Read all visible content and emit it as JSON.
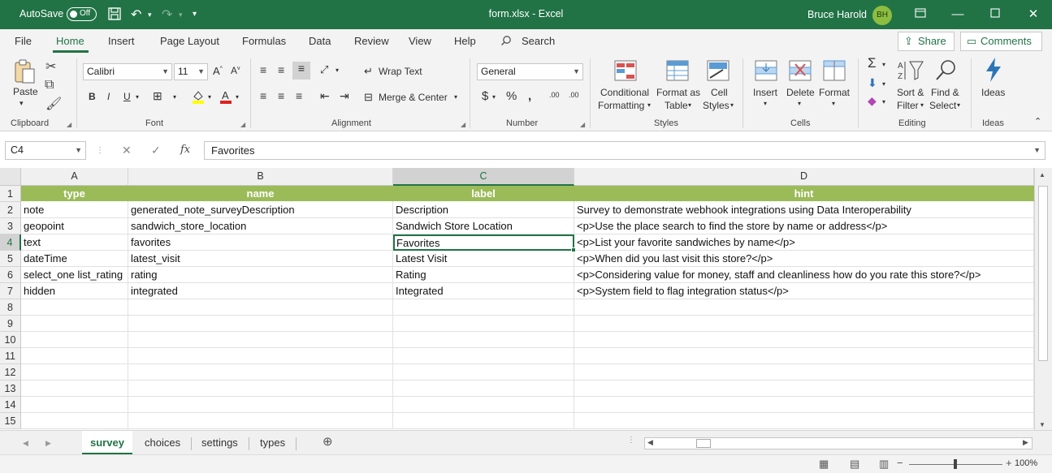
{
  "titlebar": {
    "autosave_label": "AutoSave",
    "autosave_state": "Off",
    "title": "form.xlsx  -  Excel",
    "user": "Bruce Harold",
    "initials": "BH"
  },
  "tabs": [
    "File",
    "Home",
    "Insert",
    "Page Layout",
    "Formulas",
    "Data",
    "Review",
    "View",
    "Help"
  ],
  "search_label": "Search",
  "share_label": "Share",
  "comments_label": "Comments",
  "ribbon": {
    "clipboard": {
      "paste": "Paste",
      "label": "Clipboard"
    },
    "font": {
      "name": "Calibri",
      "size": "11",
      "label": "Font"
    },
    "alignment": {
      "wrap": "Wrap Text",
      "merge": "Merge & Center",
      "label": "Alignment"
    },
    "number": {
      "format": "General",
      "label": "Number"
    },
    "styles": {
      "conditional_1": "Conditional",
      "conditional_2": "Formatting",
      "format_table_1": "Format as",
      "format_table_2": "Table",
      "cell_styles_1": "Cell",
      "cell_styles_2": "Styles",
      "label": "Styles"
    },
    "cells": {
      "insert": "Insert",
      "delete": "Delete",
      "format": "Format",
      "label": "Cells"
    },
    "editing": {
      "sort_1": "Sort &",
      "sort_2": "Filter",
      "find_1": "Find &",
      "find_2": "Select",
      "label": "Editing"
    },
    "ideas": {
      "button": "Ideas",
      "label": "Ideas"
    }
  },
  "formula_bar": {
    "name_box": "C4",
    "fx": "fx",
    "value": "Favorites"
  },
  "columns": [
    "A",
    "B",
    "C",
    "D"
  ],
  "rows": [
    [
      "type",
      "name",
      "label",
      "hint"
    ],
    [
      "note",
      "generated_note_surveyDescription",
      "Description",
      "Survey to demonstrate webhook integrations using Data Interoperability"
    ],
    [
      "geopoint",
      "sandwich_store_location",
      "Sandwich Store Location",
      "<p>Use the place search to find the store by name or address</p>"
    ],
    [
      "text",
      "favorites",
      "Favorites",
      "<p>List your favorite sandwiches by name</p>"
    ],
    [
      "dateTime",
      "latest_visit",
      "Latest Visit",
      "<p>When did you last visit this store?</p>"
    ],
    [
      "select_one list_rating",
      "rating",
      "Rating",
      "<p>Considering value for money, staff and cleanliness how do you rate this store?</p>"
    ],
    [
      "hidden",
      "integrated",
      "Integrated",
      "<p>System field to flag integration status</p>"
    ],
    [
      "",
      "",
      "",
      ""
    ],
    [
      "",
      "",
      "",
      ""
    ],
    [
      "",
      "",
      "",
      ""
    ],
    [
      "",
      "",
      "",
      ""
    ],
    [
      "",
      "",
      "",
      ""
    ],
    [
      "",
      "",
      "",
      ""
    ],
    [
      "",
      "",
      "",
      ""
    ],
    [
      "",
      "",
      "",
      ""
    ]
  ],
  "row_numbers": [
    "1",
    "2",
    "3",
    "4",
    "5",
    "6",
    "7",
    "8",
    "9",
    "10",
    "11",
    "12",
    "13",
    "14",
    "15"
  ],
  "sheets": [
    "survey",
    "choices",
    "settings",
    "types"
  ],
  "zoom": "100%",
  "colors": {
    "excel_green": "#217346",
    "header_fill": "#9bbb59"
  }
}
